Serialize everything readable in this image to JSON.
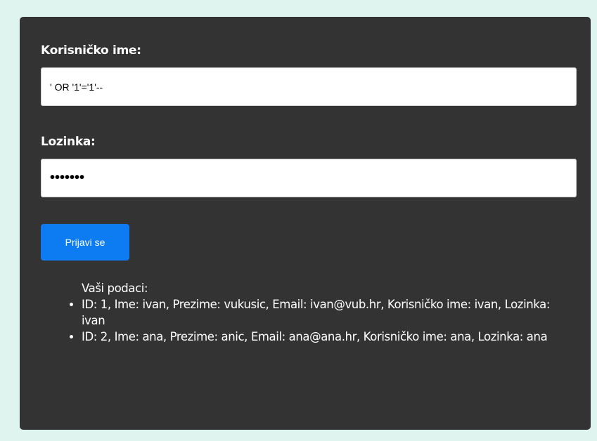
{
  "form": {
    "username_label": "Korisničko ime:",
    "username_value": "' OR '1'='1'--",
    "password_label": "Lozinka:",
    "password_value": "•••••••",
    "submit_label": "Prijavi se"
  },
  "results": {
    "heading": "Vaši podaci:",
    "items": [
      "ID: 1, Ime: ivan, Prezime: vukusic, Email: ivan@vub.hr, Korisničko ime: ivan, Lozinka: ivan",
      "ID: 2, Ime: ana, Prezime: anic, Email: ana@ana.hr, Korisničko ime: ana, Lozinka: ana"
    ]
  },
  "colors": {
    "page_background": "#dff3ef",
    "card_background": "#333333",
    "button_background": "#0d7cf2"
  }
}
